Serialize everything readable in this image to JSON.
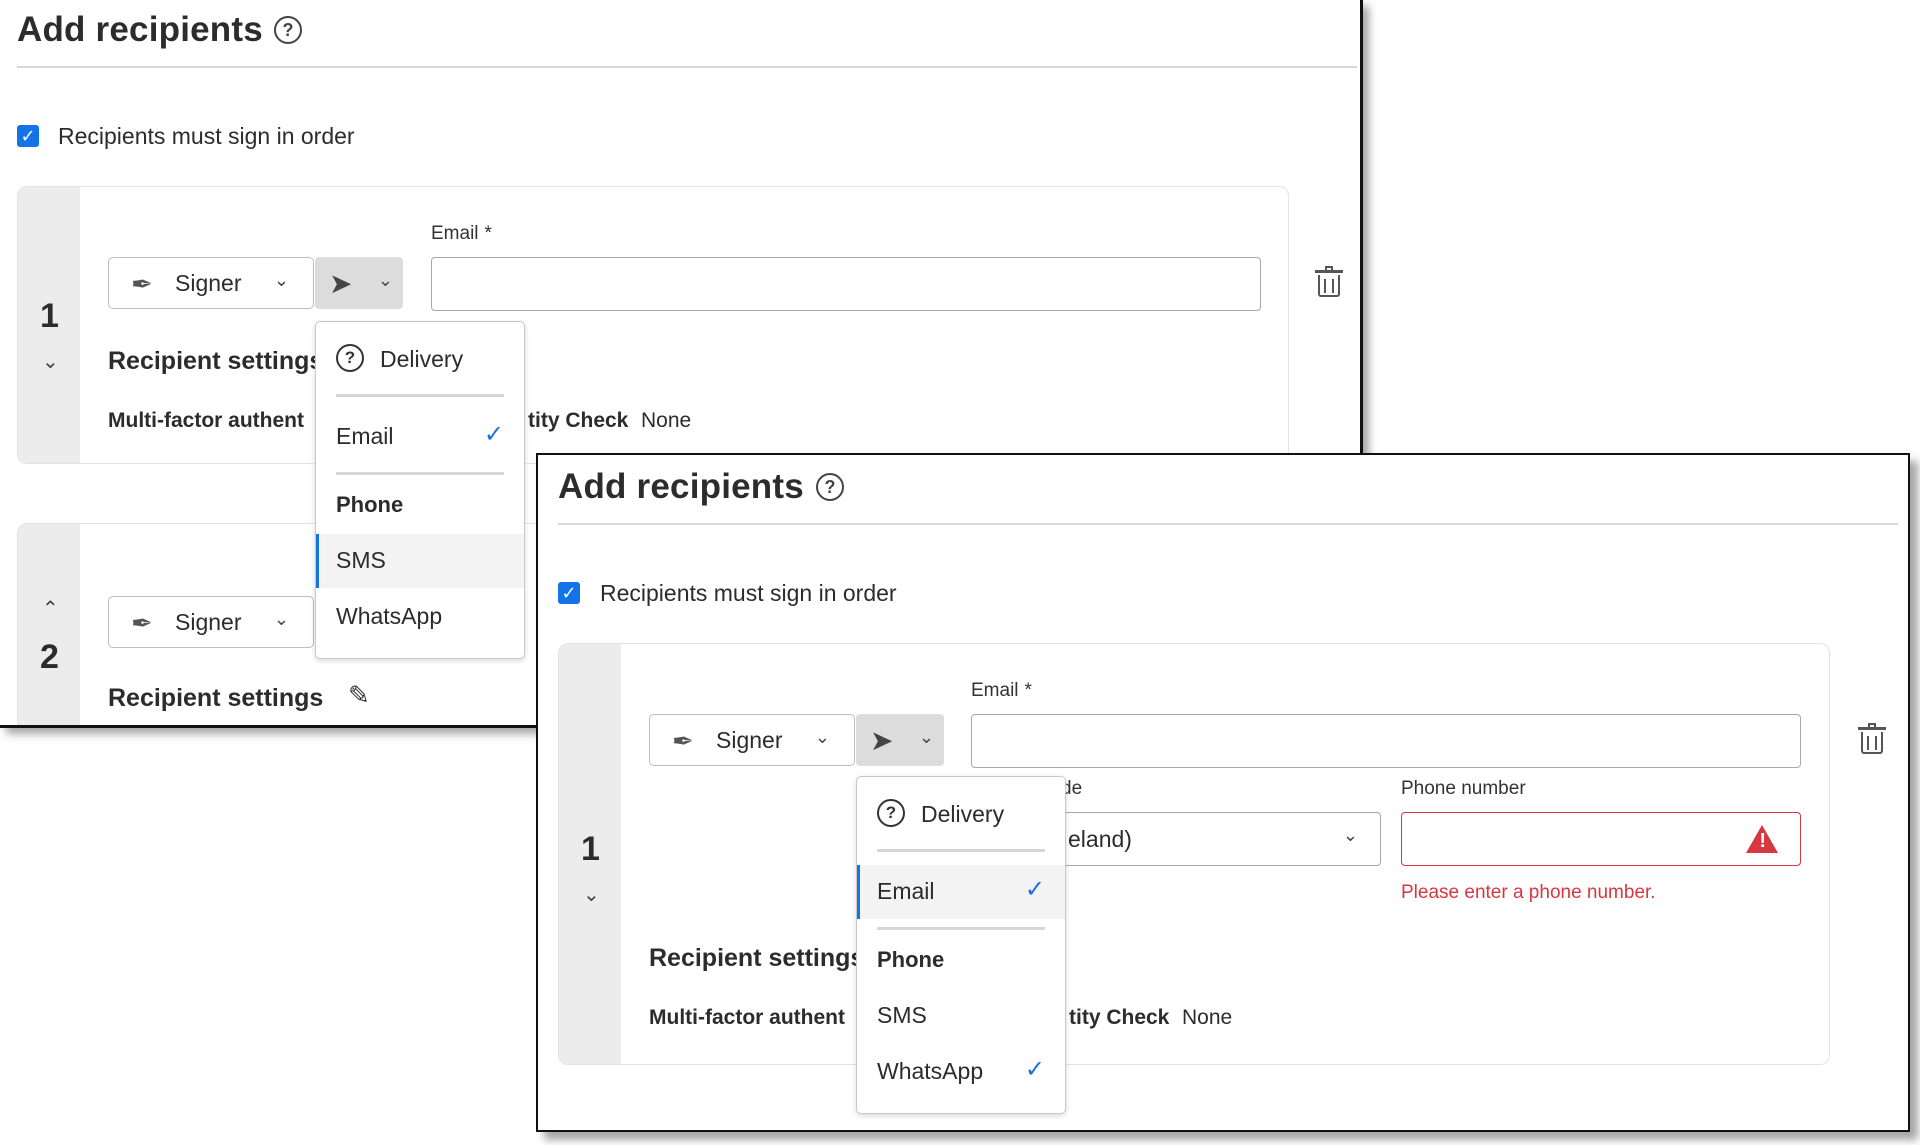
{
  "panel_a": {
    "title": "Add recipients",
    "sign_in_order_label": "Recipients must sign in order",
    "recipient_1": {
      "order": "1",
      "role_label": "Signer",
      "email_label": "Email",
      "required_mark": "*",
      "email_value": "",
      "settings_title": "Recipient settings",
      "mfa_label_visible": "Multi-factor authent",
      "identity_label_visible": "tity Check",
      "identity_value": "None"
    },
    "recipient_2": {
      "order": "2",
      "role_label": "Signer",
      "settings_title": "Recipient settings"
    },
    "delivery_menu": {
      "header": "Delivery",
      "email_item": "Email",
      "phone_group": "Phone",
      "sms_item": "SMS",
      "whatsapp_item": "WhatsApp"
    }
  },
  "panel_b": {
    "title": "Add recipients",
    "sign_in_order_label": "Recipients must sign in order",
    "recipient_1": {
      "order": "1",
      "role_label": "Signer",
      "email_label": "Email",
      "required_mark": "*",
      "email_value": "",
      "country_label_visible": "de",
      "country_value_visible": "eland)",
      "phone_label": "Phone number",
      "phone_value": "",
      "phone_error": "Please enter a phone number.",
      "settings_title": "Recipient settings",
      "mfa_label_visible": "Multi-factor authent",
      "identity_label_visible": "tity Check",
      "identity_value": "None"
    },
    "delivery_menu": {
      "header": "Delivery",
      "email_item": "Email",
      "phone_group": "Phone",
      "sms_item": "SMS",
      "whatsapp_item": "WhatsApp"
    }
  },
  "colors": {
    "accent": "#1473e6",
    "error": "#d7373f",
    "rail": "#ececec"
  }
}
